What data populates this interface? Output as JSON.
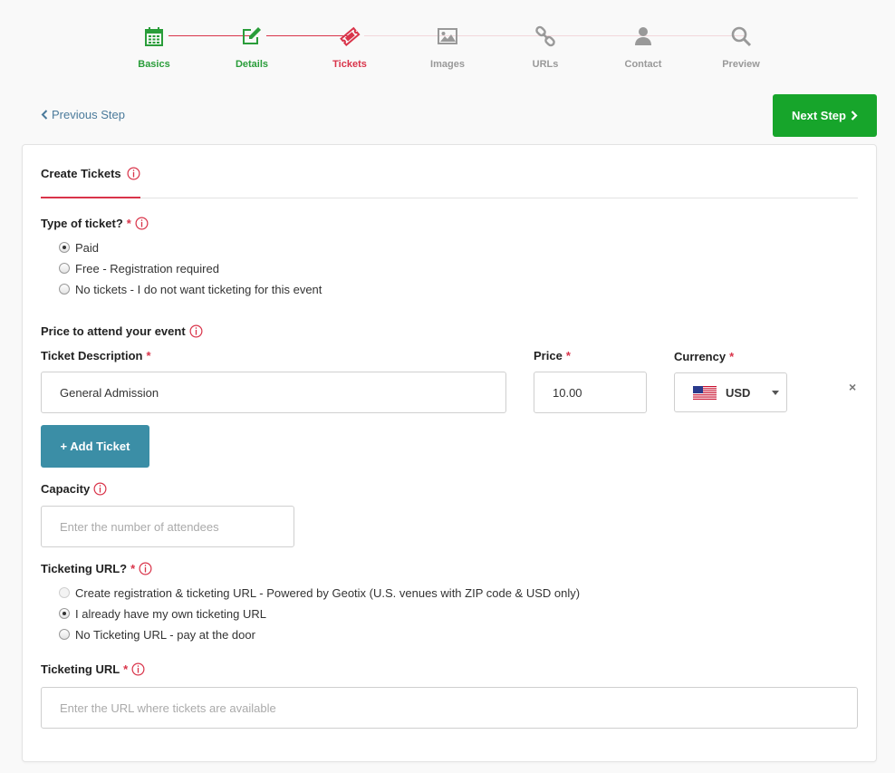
{
  "stepper": {
    "steps": [
      {
        "label": "Basics",
        "icon": "calendar-icon",
        "state": "done"
      },
      {
        "label": "Details",
        "icon": "edit-icon",
        "state": "done"
      },
      {
        "label": "Tickets",
        "icon": "ticket-icon",
        "state": "active"
      },
      {
        "label": "Images",
        "icon": "image-icon",
        "state": "todo"
      },
      {
        "label": "URLs",
        "icon": "link-icon",
        "state": "todo"
      },
      {
        "label": "Contact",
        "icon": "user-icon",
        "state": "todo"
      },
      {
        "label": "Preview",
        "icon": "search-icon",
        "state": "todo"
      }
    ]
  },
  "nav": {
    "previous_label": "Previous Step",
    "next_label": "Next Step"
  },
  "card": {
    "title": "Create Tickets",
    "ticket_type": {
      "label": "Type of ticket?",
      "required_mark": "*",
      "options": [
        {
          "label": "Paid",
          "checked": true
        },
        {
          "label": "Free - Registration required",
          "checked": false
        },
        {
          "label": "No tickets - I do not want ticketing for this event",
          "checked": false
        }
      ]
    },
    "price_section": {
      "title": "Price to attend your event",
      "description_label": "Ticket Description",
      "description_value": "General Admission",
      "price_label": "Price",
      "price_value": "10.00",
      "currency_label": "Currency",
      "currency_value": "USD",
      "remove_label": "×",
      "required_mark": "*"
    },
    "add_ticket_label": "+ Add Ticket",
    "capacity": {
      "label": "Capacity",
      "placeholder": "Enter the number of attendees"
    },
    "ticketing_url_choice": {
      "label": "Ticketing URL?",
      "required_mark": "*",
      "options": [
        {
          "label": "Create registration & ticketing URL - Powered by Geotix (U.S. venues with ZIP code & USD only)",
          "checked": false,
          "disabled": true
        },
        {
          "label": "I already have my own ticketing URL",
          "checked": true,
          "disabled": false
        },
        {
          "label": "No Ticketing URL - pay at the door",
          "checked": false,
          "disabled": false
        }
      ]
    },
    "ticketing_url": {
      "label": "Ticketing URL",
      "required_mark": "*",
      "placeholder": "Enter the URL where tickets are available"
    }
  },
  "colors": {
    "done": "#2a9d3a",
    "active": "#d9344a",
    "todo": "#999999",
    "next_button": "#17a52b",
    "add_ticket_button": "#3b8ea6"
  }
}
